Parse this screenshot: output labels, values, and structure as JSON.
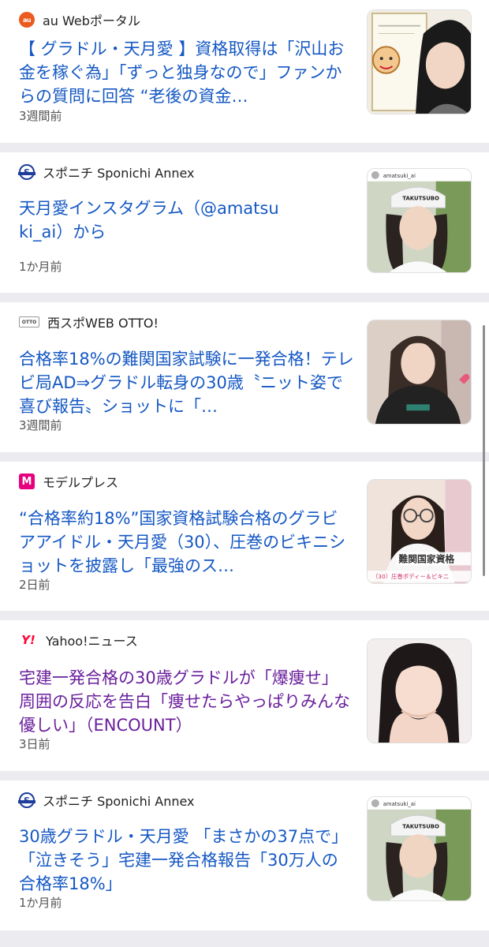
{
  "articles": [
    {
      "source": "au Webポータル",
      "source_icon": "au-web-portal-logo",
      "headline": "【 グラドル・天月愛 】資格取得は「沢山お金を稼ぐ為」「ずっと独身なので」ファンからの質問に回答 “老後の資金…",
      "time": "3週間前",
      "visited": false
    },
    {
      "source": "スポニチ Sponichi Annex",
      "source_icon": "sponichi-logo",
      "headline": "天月愛インスタグラム（@amatsuki_ai）から",
      "time": "1か月前",
      "visited": false
    },
    {
      "source": "西スポWEB OTTO!",
      "source_icon": "nishispo-otto-logo",
      "headline": "合格率18%の難関国家試験に一発合格！テレビ局AD⇒グラドル転身の30歳〝ニット姿で喜び報告〟ショットに「…",
      "time": "3週間前",
      "visited": false
    },
    {
      "source": "モデルプレス",
      "source_icon": "modelpress-logo",
      "headline": "“合格率約18%”国家資格試験合格のグラビアアイドル・天月愛（30）、圧巻のビキニショットを披露し「最強のス…",
      "time": "2日前",
      "visited": false
    },
    {
      "source": "Yahoo!ニュース",
      "source_icon": "yahoo-logo",
      "headline": "宅建一発合格の30歳グラドルが「爆痩せ」 周囲の反応を告白「痩せたらやっぱりみんな優しい」（ENCOUNT）",
      "time": "3日前",
      "visited": true
    },
    {
      "source": "スポニチ Sponichi Annex",
      "source_icon": "sponichi-logo",
      "headline": "30歳グラドル・天月愛 「まさかの37点で」「泣きそう」宅建一発合格報告「30万人の合格率18%」",
      "time": "1か月前",
      "visited": false
    }
  ],
  "thumb_captions": {
    "insta_handle": "amatsuki_ai",
    "cap_text": "TAKUTSUBO",
    "modelpress_overlay_big": "難関国家資格",
    "modelpress_overlay_small": "（30）圧巻ボディー＆ビキニ"
  },
  "colors": {
    "link": "#1558c4",
    "visited": "#6a1f9c",
    "separator": "#ebebf0"
  }
}
